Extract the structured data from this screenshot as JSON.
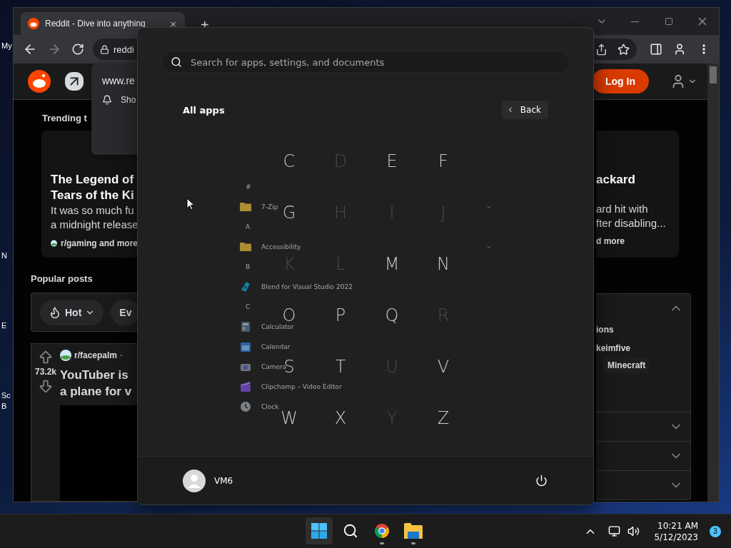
{
  "desktop": {
    "icon_labels": [
      {
        "label": "My"
      },
      {
        "label": "N"
      },
      {
        "label": "E"
      },
      {
        "label": "Sc"
      },
      {
        "label": "B"
      }
    ]
  },
  "browser": {
    "tab": {
      "title": "Reddit - Dive into anything",
      "close": "×"
    },
    "new_tab": "+",
    "address": "reddi",
    "site_popup": {
      "site": "www.re",
      "item": "Sho"
    },
    "header": {
      "login": "Log In"
    },
    "trending": {
      "heading": "Trending t",
      "left_card": {
        "title_lines": [
          "The Legend of",
          "Tears of the Ki"
        ],
        "body_lines": [
          "It was so much fu",
          "a midnight release"
        ],
        "source": "r/gaming and more"
      },
      "right_card": {
        "title": "ackard",
        "body_lines": [
          "ard hit with",
          "fter disabling..."
        ],
        "source": "d more"
      }
    },
    "popular": {
      "heading": "Popular posts",
      "sort": "Hot",
      "next_filter": "Ev"
    },
    "post": {
      "votes": "73.2k",
      "subreddit": "r/facepalm",
      "separator": "·",
      "title_lines": [
        "YouTuber is",
        "a plane for v"
      ]
    },
    "side_panel": {
      "sections": [
        {
          "expanded": true,
          "lines": [
            "ions",
            "keimfive"
          ],
          "chip": "Minecraft"
        },
        {
          "expanded": false
        },
        {
          "expanded": false
        },
        {
          "expanded": false
        }
      ]
    }
  },
  "start_menu": {
    "search": {
      "placeholder": "Search for apps, settings, and documents"
    },
    "title": "All apps",
    "back": "Back",
    "apps": [
      {
        "kind": "header",
        "label": "#"
      },
      {
        "kind": "folder",
        "label": "7-Zip",
        "expanded": false
      },
      {
        "kind": "header",
        "label": "A"
      },
      {
        "kind": "folder",
        "label": "Accessibility",
        "expanded": false
      },
      {
        "kind": "header",
        "label": "B"
      },
      {
        "kind": "app",
        "label": "Blend for Visual Studio 2022"
      },
      {
        "kind": "header",
        "label": "C"
      },
      {
        "kind": "app",
        "label": "Calculator"
      },
      {
        "kind": "app",
        "label": "Calendar"
      },
      {
        "kind": "app",
        "label": "Camera"
      },
      {
        "kind": "app",
        "label": "Clipchamp – Video Editor"
      },
      {
        "kind": "app",
        "label": "Clock"
      }
    ],
    "letters": [
      {
        "label": "C",
        "enabled": true
      },
      {
        "label": "D",
        "enabled": false
      },
      {
        "label": "E",
        "enabled": true
      },
      {
        "label": "F",
        "enabled": true
      },
      {
        "label": "G",
        "enabled": true
      },
      {
        "label": "H",
        "enabled": false
      },
      {
        "label": "I",
        "enabled": false
      },
      {
        "label": "J",
        "enabled": false
      },
      {
        "label": "K",
        "enabled": false
      },
      {
        "label": "L",
        "enabled": false
      },
      {
        "label": "M",
        "enabled": true
      },
      {
        "label": "N",
        "enabled": true
      },
      {
        "label": "O",
        "enabled": true
      },
      {
        "label": "P",
        "enabled": true
      },
      {
        "label": "Q",
        "enabled": true
      },
      {
        "label": "R",
        "enabled": false
      },
      {
        "label": "S",
        "enabled": true
      },
      {
        "label": "T",
        "enabled": true
      },
      {
        "label": "U",
        "enabled": false
      },
      {
        "label": "V",
        "enabled": true
      },
      {
        "label": "W",
        "enabled": true
      },
      {
        "label": "X",
        "enabled": true
      },
      {
        "label": "Y",
        "enabled": false
      },
      {
        "label": "Z",
        "enabled": true
      }
    ],
    "user": {
      "name": "VM6"
    }
  },
  "taskbar": {
    "apps": [
      {
        "kind": "start",
        "active": true,
        "running": false
      },
      {
        "kind": "search",
        "active": false,
        "running": false
      },
      {
        "kind": "browser",
        "active": false,
        "running": true
      },
      {
        "kind": "files",
        "active": false,
        "running": true
      }
    ],
    "time": "10:21 AM",
    "date": "5/12/2023",
    "notifications": "3"
  }
}
